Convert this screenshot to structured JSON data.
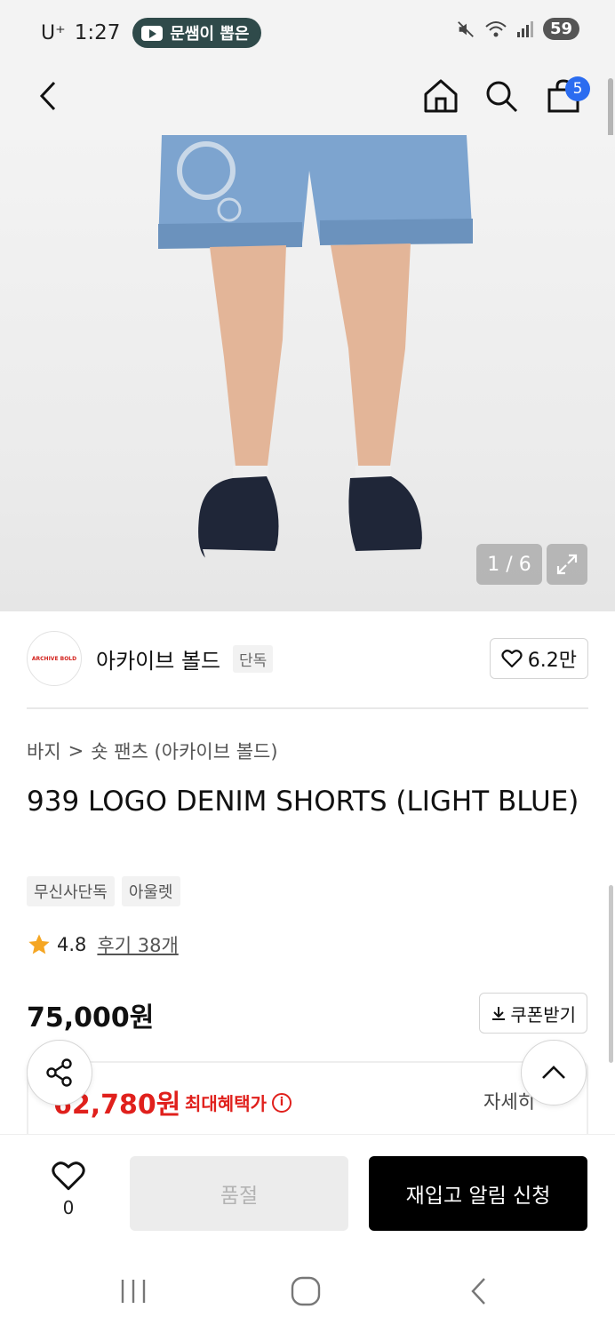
{
  "status_bar": {
    "carrier": "U⁺",
    "time": "1:27",
    "notification_pill": "문쌤이 뽑은",
    "battery": "59"
  },
  "nav": {
    "cart_count": "5"
  },
  "gallery": {
    "counter": "1 / 6"
  },
  "brand": {
    "logo_text": "ARCHIVE BOLD",
    "name": "아카이브 볼드",
    "tag": "단독",
    "likes": "6.2만"
  },
  "breadcrumb": {
    "category": "바지",
    "separator": ">",
    "subcategory": "숏 팬츠 (아카이브 볼드)"
  },
  "product": {
    "title": "939 LOGO DENIM SHORTS (LIGHT BLUE)",
    "tags": [
      "무신사단독",
      "아울렛"
    ],
    "rating": "4.8",
    "reviews": "후기 38개",
    "price": "75,000원",
    "coupon_label": "쿠폰받기"
  },
  "benefit": {
    "price": "62,780원",
    "label": "최대혜택가",
    "detail": "자세히"
  },
  "action_bar": {
    "wish_count": "0",
    "soldout_label": "품절",
    "notify_label": "재입고 알림 신청"
  },
  "colors": {
    "accent_red": "#e0201c",
    "badge_blue": "#2b6cf0",
    "cta_black": "#000000"
  }
}
